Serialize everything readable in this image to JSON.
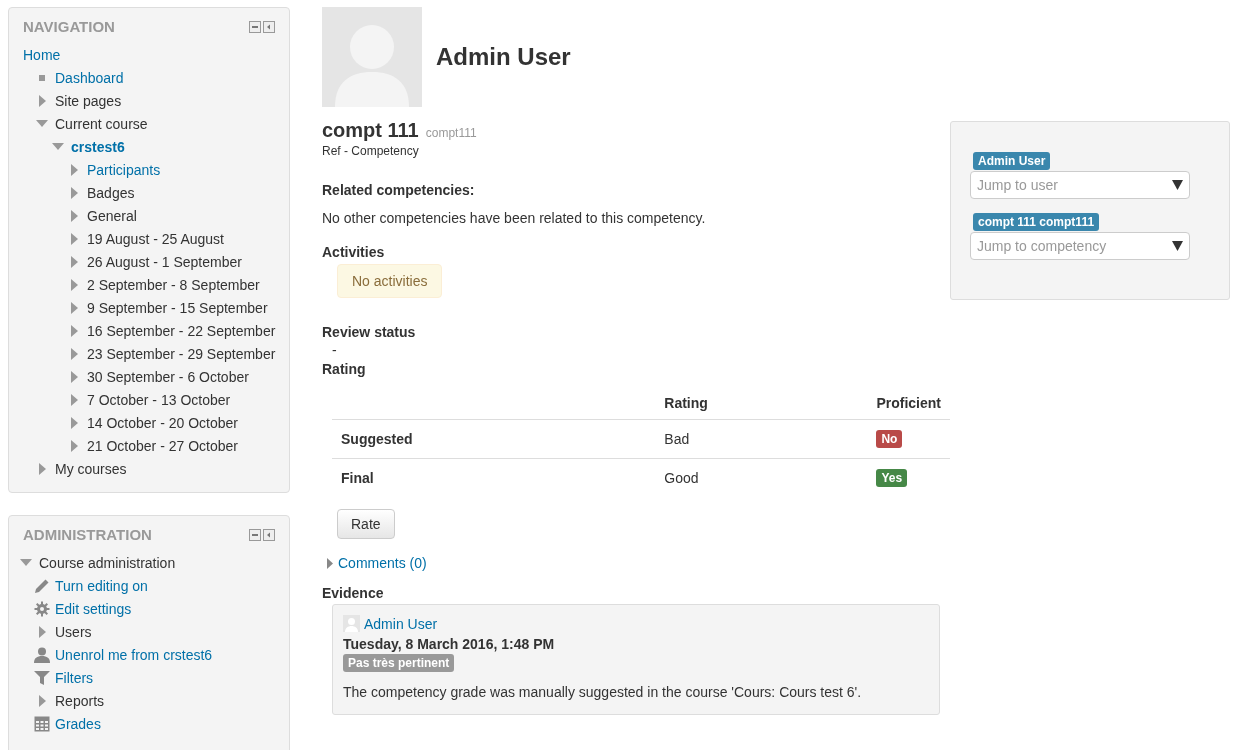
{
  "navigation": {
    "title": "NAVIGATION",
    "tree": [
      {
        "label": "Home",
        "link": true,
        "kind": "plain",
        "children": [
          {
            "label": "Dashboard",
            "link": true,
            "kind": "square"
          },
          {
            "label": "Site pages",
            "link": false,
            "kind": "arrow",
            "expanded": false
          },
          {
            "label": "Current course",
            "link": false,
            "kind": "arrow",
            "expanded": true,
            "children": [
              {
                "label": "crstest6",
                "link": true,
                "current": true,
                "kind": "arrow",
                "expanded": true,
                "children": [
                  {
                    "label": "Participants",
                    "link": true,
                    "kind": "arrow",
                    "expanded": false
                  },
                  {
                    "label": "Badges",
                    "link": false,
                    "kind": "arrow",
                    "expanded": false
                  },
                  {
                    "label": "General",
                    "link": false,
                    "kind": "arrow",
                    "expanded": false
                  },
                  {
                    "label": "19 August - 25 August",
                    "link": false,
                    "kind": "arrow",
                    "expanded": false
                  },
                  {
                    "label": "26 August - 1 September",
                    "link": false,
                    "kind": "arrow",
                    "expanded": false
                  },
                  {
                    "label": "2 September - 8 September",
                    "link": false,
                    "kind": "arrow",
                    "expanded": false
                  },
                  {
                    "label": "9 September - 15 September",
                    "link": false,
                    "kind": "arrow",
                    "expanded": false
                  },
                  {
                    "label": "16 September - 22 September",
                    "link": false,
                    "kind": "arrow",
                    "expanded": false
                  },
                  {
                    "label": "23 September - 29 September",
                    "link": false,
                    "kind": "arrow",
                    "expanded": false
                  },
                  {
                    "label": "30 September - 6 October",
                    "link": false,
                    "kind": "arrow",
                    "expanded": false
                  },
                  {
                    "label": "7 October - 13 October",
                    "link": false,
                    "kind": "arrow",
                    "expanded": false
                  },
                  {
                    "label": "14 October - 20 October",
                    "link": false,
                    "kind": "arrow",
                    "expanded": false
                  },
                  {
                    "label": "21 October - 27 October",
                    "link": false,
                    "kind": "arrow",
                    "expanded": false
                  }
                ]
              }
            ]
          },
          {
            "label": "My courses",
            "link": false,
            "kind": "arrow",
            "expanded": false
          }
        ]
      }
    ]
  },
  "administration": {
    "title": "ADMINISTRATION",
    "tree": [
      {
        "label": "Course administration",
        "link": false,
        "kind": "arrow",
        "expanded": true,
        "children": [
          {
            "label": "Turn editing on",
            "link": true,
            "kind": "pencil"
          },
          {
            "label": "Edit settings",
            "link": true,
            "kind": "gear"
          },
          {
            "label": "Users",
            "link": false,
            "kind": "arrow",
            "expanded": false
          },
          {
            "label": "Unenrol me from crstest6",
            "link": true,
            "kind": "person"
          },
          {
            "label": "Filters",
            "link": true,
            "kind": "filter"
          },
          {
            "label": "Reports",
            "link": false,
            "kind": "arrow",
            "expanded": false
          },
          {
            "label": "Grades",
            "link": true,
            "kind": "table"
          }
        ]
      }
    ]
  },
  "user": {
    "name": "Admin User"
  },
  "competency": {
    "name": "compt 111",
    "idnumber": "compt111",
    "framework": "Ref - Competency"
  },
  "related": {
    "heading": "Related competencies:",
    "text": "No other competencies have been related to this competency."
  },
  "activities": {
    "heading": "Activities",
    "notice": "No activities"
  },
  "review": {
    "heading": "Review status",
    "value": "-"
  },
  "rating": {
    "heading": "Rating",
    "columns": [
      "Rating",
      "Proficient"
    ],
    "rows": [
      {
        "label": "Suggested",
        "rating": "Bad",
        "proficient_text": "No",
        "proficient": false
      },
      {
        "label": "Final",
        "rating": "Good",
        "proficient_text": "Yes",
        "proficient": true
      }
    ],
    "button": "Rate"
  },
  "comments": {
    "label": "Comments (0)"
  },
  "evidence": {
    "heading": "Evidence",
    "items": [
      {
        "user": "Admin User",
        "date": "Tuesday, 8 March 2016, 1:48 PM",
        "grade": "Pas très pertinent",
        "description": "The competency grade was manually suggested in the course 'Cours: Cours test 6'."
      }
    ]
  },
  "navigator": {
    "user_label": "Admin User",
    "user_placeholder": "Jump to user",
    "competency_label": "compt 111 compt111",
    "competency_placeholder": "Jump to competency"
  }
}
